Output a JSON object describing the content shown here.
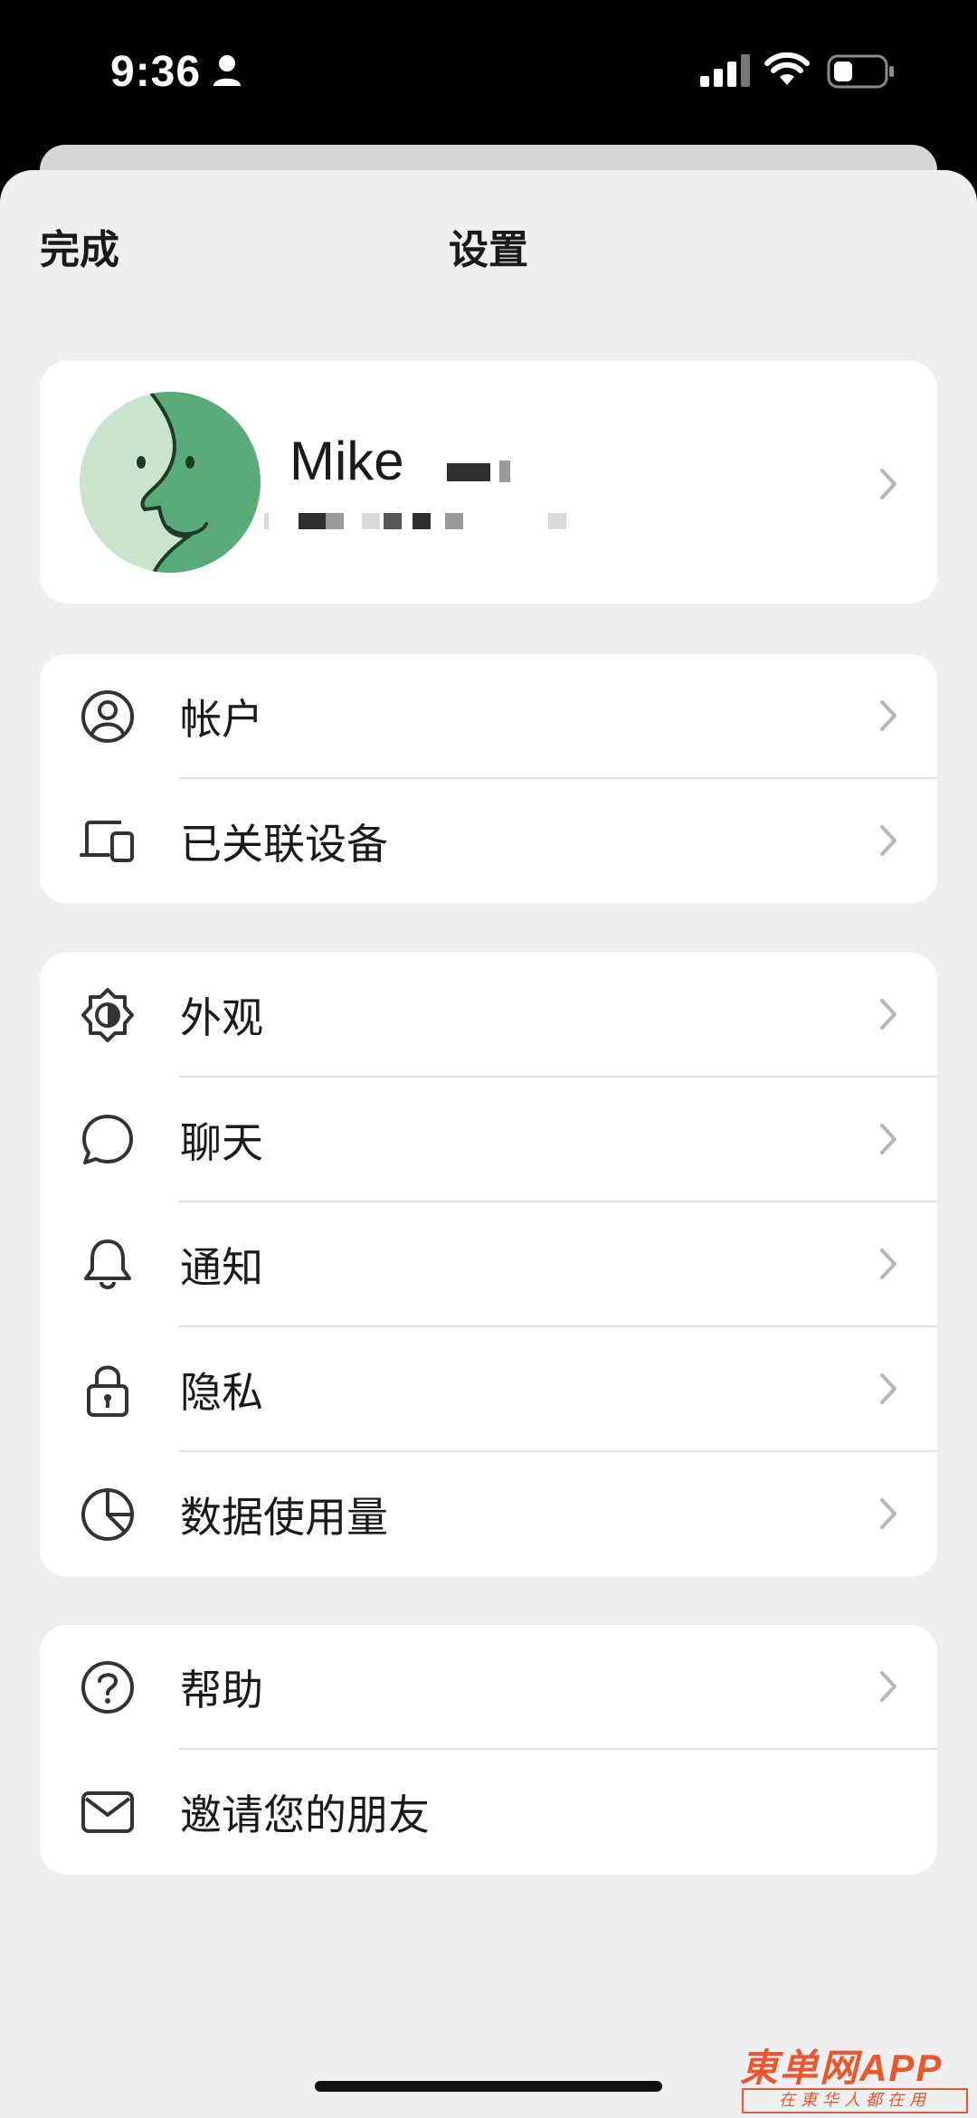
{
  "status_bar": {
    "time": "9:36"
  },
  "nav": {
    "done_label": "完成",
    "title": "设置"
  },
  "profile": {
    "name": "Mike"
  },
  "groups": [
    {
      "items": [
        {
          "label": "帐户",
          "icon": "account-icon"
        },
        {
          "label": "已关联设备",
          "icon": "linked-devices-icon"
        }
      ]
    },
    {
      "items": [
        {
          "label": "外观",
          "icon": "appearance-icon"
        },
        {
          "label": "聊天",
          "icon": "chat-icon"
        },
        {
          "label": "通知",
          "icon": "bell-icon"
        },
        {
          "label": "隐私",
          "icon": "lock-icon"
        },
        {
          "label": "数据使用量",
          "icon": "data-usage-icon"
        }
      ]
    },
    {
      "items": [
        {
          "label": "帮助",
          "icon": "help-icon"
        },
        {
          "label": "邀请您的朋友",
          "icon": "mail-icon"
        }
      ]
    }
  ],
  "watermark": {
    "main": "東单网APP",
    "sub": "在東华人都在用"
  },
  "colors": {
    "avatar_light": "#c8e4cf",
    "avatar_dark": "#5aab7a",
    "background": "#efefef",
    "watermark": "#e8572f"
  }
}
